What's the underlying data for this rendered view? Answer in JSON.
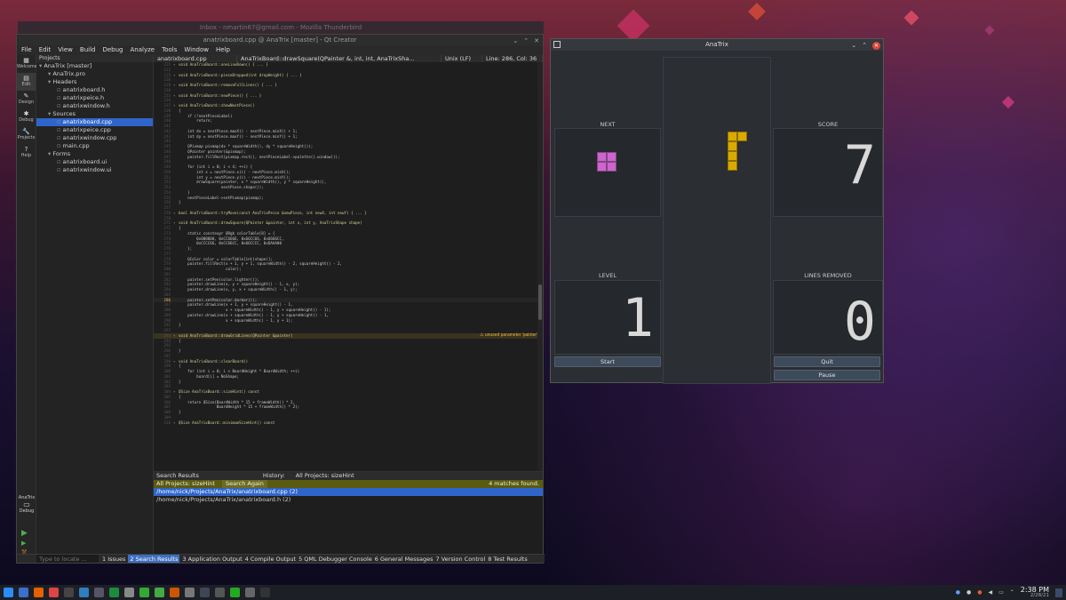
{
  "thunderbird": {
    "title": "Inbox - nmartin67@gmail.com - Mozilla Thunderbird"
  },
  "qtcreator": {
    "title": "anatrixboard.cpp @ AnaTrix [master] - Qt Creator",
    "menu": [
      "File",
      "Edit",
      "View",
      "Build",
      "Debug",
      "Analyze",
      "Tools",
      "Window",
      "Help"
    ],
    "modes": [
      {
        "label": "Welcome",
        "icon": "welcome-icon",
        "glyph": "▦"
      },
      {
        "label": "Edit",
        "icon": "edit-icon",
        "glyph": "▤"
      },
      {
        "label": "Design",
        "icon": "design-icon",
        "glyph": "✎"
      },
      {
        "label": "Debug",
        "icon": "debug-icon",
        "glyph": "✱"
      },
      {
        "label": "Projects",
        "icon": "projects-icon",
        "glyph": "🔧"
      },
      {
        "label": "Help",
        "icon": "help-icon",
        "glyph": "?"
      }
    ],
    "kit": {
      "name": "AnaTrix",
      "mode": "Debug"
    },
    "projects_header": "Projects",
    "tree": [
      {
        "label": "AnaTrix [master]",
        "indent": 0,
        "selected": false
      },
      {
        "label": "AnaTrix.pro",
        "indent": 1,
        "selected": false
      },
      {
        "label": "Headers",
        "indent": 1,
        "selected": false
      },
      {
        "label": "anatrixboard.h",
        "indent": 2,
        "selected": false
      },
      {
        "label": "anatrixpeice.h",
        "indent": 2,
        "selected": false
      },
      {
        "label": "anatrixwindow.h",
        "indent": 2,
        "selected": false
      },
      {
        "label": "Sources",
        "indent": 1,
        "selected": false
      },
      {
        "label": "anatrixboard.cpp",
        "indent": 2,
        "selected": true
      },
      {
        "label": "anatrixpeice.cpp",
        "indent": 2,
        "selected": false
      },
      {
        "label": "anatrixwindow.cpp",
        "indent": 2,
        "selected": false
      },
      {
        "label": "main.cpp",
        "indent": 2,
        "selected": false
      },
      {
        "label": "Forms",
        "indent": 1,
        "selected": false
      },
      {
        "label": "anatrixboard.ui",
        "indent": 2,
        "selected": false
      },
      {
        "label": "anatrixwindow.ui",
        "indent": 2,
        "selected": false
      }
    ],
    "editor": {
      "file_tab": "anatrixboard.cpp",
      "symbol_tab": "AnaTrixBoard::drawSquare(QPainter &, int, int, AnaTrixSha...",
      "line_ending": "Unix (LF)",
      "position": "Line: 286, Col: 36",
      "warning": "⚠ unused parameter 'painter'",
      "lines": [
        {
          "n": "221",
          "t": "void AnaTrixBoard::oneLineDown() { ... }"
        },
        {
          "n": "222",
          "t": ""
        },
        {
          "n": "225",
          "t": "void AnaTrixBoard::pieceDropped(int dropHeight) { ... }"
        },
        {
          "n": "226",
          "t": ""
        },
        {
          "n": "229",
          "t": "void AnaTrixBoard::removeFullLines() { ... }"
        },
        {
          "n": "230",
          "t": ""
        },
        {
          "n": "233",
          "t": "void AnaTrixBoard::newPiece() { ... }"
        },
        {
          "n": "234",
          "t": ""
        },
        {
          "n": "237",
          "t": "void AnaTrixBoard::showNextPiece()"
        },
        {
          "n": "238",
          "t": "{"
        },
        {
          "n": "239",
          "t": "    if (!nextPieceLabel)"
        },
        {
          "n": "240",
          "t": "        return;"
        },
        {
          "n": "241",
          "t": ""
        },
        {
          "n": "242",
          "t": "    int dx = nextPiece.maxX() - nextPiece.minX() + 1;"
        },
        {
          "n": "243",
          "t": "    int dy = nextPiece.maxY() - nextPiece.minY() + 1;"
        },
        {
          "n": "244",
          "t": ""
        },
        {
          "n": "245",
          "t": "    QPixmap pixmap(dx * squareWidth(), dy * squareHeight());"
        },
        {
          "n": "246",
          "t": "    QPainter painter(&pixmap);"
        },
        {
          "n": "247",
          "t": "    painter.fillRect(pixmap.rect(), nextPieceLabel->palette().window());"
        },
        {
          "n": "248",
          "t": ""
        },
        {
          "n": "249",
          "t": "    for (int i = 0; i < 4; ++i) {"
        },
        {
          "n": "250",
          "t": "        int x = nextPiece.x(i) - nextPiece.minX();"
        },
        {
          "n": "251",
          "t": "        int y = nextPiece.y(i) - nextPiece.minY();"
        },
        {
          "n": "252",
          "t": "        drawSquare(painter, x * squareWidth(), y * squareHeight(),"
        },
        {
          "n": "253",
          "t": "                   nextPiece.shape());"
        },
        {
          "n": "254",
          "t": "    }"
        },
        {
          "n": "255",
          "t": "    nextPieceLabel->setPixmap(pixmap);"
        },
        {
          "n": "256",
          "t": "}"
        },
        {
          "n": "257",
          "t": ""
        },
        {
          "n": "258",
          "t": "bool AnaTrixBoard::tryMove(const AnaTrixPeice &newPiece, int newX, int newY) { ... }"
        },
        {
          "n": "270",
          "t": ""
        },
        {
          "n": "271",
          "t": "void AnaTrixBoard::drawSquare(QPainter &painter, int x, int y, AnaTrixShape shape)"
        },
        {
          "n": "272",
          "t": "{"
        },
        {
          "n": "273",
          "t": "    static constexpr QRgb colorTable[8] = {"
        },
        {
          "n": "274",
          "t": "        0x000000, 0xCC6666, 0x66CC66, 0x6666CC,"
        },
        {
          "n": "275",
          "t": "        0xCCCC66, 0xCC66CC, 0x66CCCC, 0xDAAA00"
        },
        {
          "n": "276",
          "t": "    };"
        },
        {
          "n": "277",
          "t": ""
        },
        {
          "n": "278",
          "t": "    QColor color = colorTable[int(shape)];"
        },
        {
          "n": "279",
          "t": "    painter.fillRect(x + 1, y + 1, squareWidth() - 2, squareHeight() - 2,"
        },
        {
          "n": "280",
          "t": "                     color);"
        },
        {
          "n": "281",
          "t": ""
        },
        {
          "n": "282",
          "t": "    painter.setPen(color.lighter());"
        },
        {
          "n": "283",
          "t": "    painter.drawLine(x, y + squareHeight() - 1, x, y);"
        },
        {
          "n": "284",
          "t": "    painter.drawLine(x, y, x + squareWidth() - 1, y);"
        },
        {
          "n": "285",
          "t": ""
        },
        {
          "n": "286",
          "t": "    painter.setPen(color.darker());"
        },
        {
          "n": "287",
          "t": "    painter.drawLine(x + 1, y + squareHeight() - 1,"
        },
        {
          "n": "288",
          "t": "                     x + squareWidth() - 1, y + squareHeight() - 1);"
        },
        {
          "n": "289",
          "t": "    painter.drawLine(x + squareWidth() - 1, y + squareHeight() - 1,"
        },
        {
          "n": "290",
          "t": "                     x + squareWidth() - 1, y + 1);"
        },
        {
          "n": "291",
          "t": "}"
        },
        {
          "n": "292",
          "t": ""
        },
        {
          "n": "293",
          "t": "void AnaTrixBoard::drawGridLines(QPainter &painter)"
        },
        {
          "n": "294",
          "t": "{"
        },
        {
          "n": "295",
          "t": ""
        },
        {
          "n": "296",
          "t": "}"
        },
        {
          "n": "297",
          "t": ""
        },
        {
          "n": "298",
          "t": "void AnaTrixBoard::clearBoard()"
        },
        {
          "n": "299",
          "t": "{"
        },
        {
          "n": "300",
          "t": "    for (int i = 0; i < BoardHeight * BoardWidth; ++i)"
        },
        {
          "n": "301",
          "t": "        board[i] = NoShape;"
        },
        {
          "n": "302",
          "t": "}"
        },
        {
          "n": "303",
          "t": ""
        },
        {
          "n": "304",
          "t": "QSize AnaTrixBoard::sizeHint() const"
        },
        {
          "n": "305",
          "t": "{"
        },
        {
          "n": "306",
          "t": "    return QSize(BoardWidth * 15 + frameWidth() * 2,"
        },
        {
          "n": "307",
          "t": "                 BoardHeight * 15 + frameWidth() * 2);"
        },
        {
          "n": "308",
          "t": "}"
        },
        {
          "n": "309",
          "t": ""
        },
        {
          "n": "310",
          "t": "QSize AnaTrixBoard::minimumSizeHint() const"
        }
      ]
    },
    "search": {
      "header": "Search Results",
      "history_label": "History:",
      "history_value": "All Projects: sizeHint",
      "scope": "All Projects: sizeHint",
      "again_button": "Search Again",
      "count": "4 matches found.",
      "results": [
        {
          "label": "/home/nick/Projects/AnaTrix/anatrixboard.cpp (2)",
          "selected": true
        },
        {
          "label": "/home/nick/Projects/AnaTrix/anatrixboard.h (2)",
          "selected": false
        }
      ]
    },
    "status": {
      "locate_placeholder": "Type to locate ...",
      "panes": [
        "1 Issues",
        "2 Search Results",
        "3 Application Output",
        "4 Compile Output",
        "5 QML Debugger Console",
        "6 General Messages",
        "7 Version Control",
        "8 Test Results"
      ],
      "active_index": 1
    }
  },
  "anatrix": {
    "title": "AnaTrix",
    "next_label": "NEXT",
    "score_label": "SCORE",
    "level_label": "LEVEL",
    "lines_label": "LINES REMOVED",
    "score": "7",
    "level": "1",
    "lines": "0",
    "start_button": "Start",
    "quit_button": "Quit",
    "pause_button": "Pause",
    "next_piece_color": "#cc66cc",
    "falling_piece_color": "#daaa00"
  },
  "taskbar": {
    "time": "2:38 PM",
    "date": "2/28/21",
    "apps": [
      "kde-menu-icon",
      "files-icon",
      "firefox-icon",
      "browser-icon",
      "terminal-icon",
      "settings-icon",
      "app-icon",
      "game-icon",
      "monitor-icon",
      "chat-icon",
      "app2-icon",
      "app3-icon",
      "qtcreator-icon",
      "editor-icon",
      "app4-icon",
      "chat2-icon",
      "tool-icon",
      "anatrix-icon"
    ]
  },
  "colors": {
    "accent": "#2f65ca",
    "search_bar": "#5a5a10",
    "warning": "#e8b03a"
  }
}
